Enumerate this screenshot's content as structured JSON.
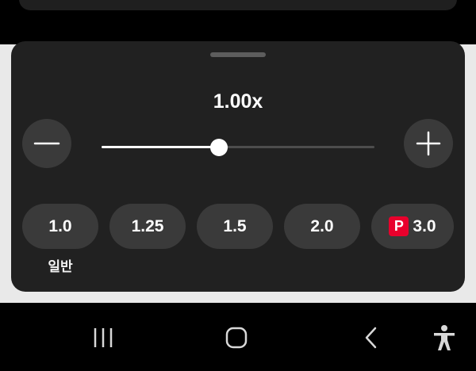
{
  "sheet": {
    "speed_display": "1.00x",
    "slider_value": 0.43,
    "minus_icon": "minus-icon",
    "plus_icon": "plus-icon"
  },
  "presets": [
    {
      "label": "1.0",
      "caption": "일반"
    },
    {
      "label": "1.25"
    },
    {
      "label": "1.5"
    },
    {
      "label": "2.0"
    },
    {
      "label": "3.0",
      "badge": "P",
      "badge_color": "#e8002c"
    }
  ],
  "navbar": {
    "recents_icon": "recents-icon",
    "home_icon": "home-icon",
    "back_icon": "back-icon",
    "accessibility_icon": "accessibility-icon"
  }
}
